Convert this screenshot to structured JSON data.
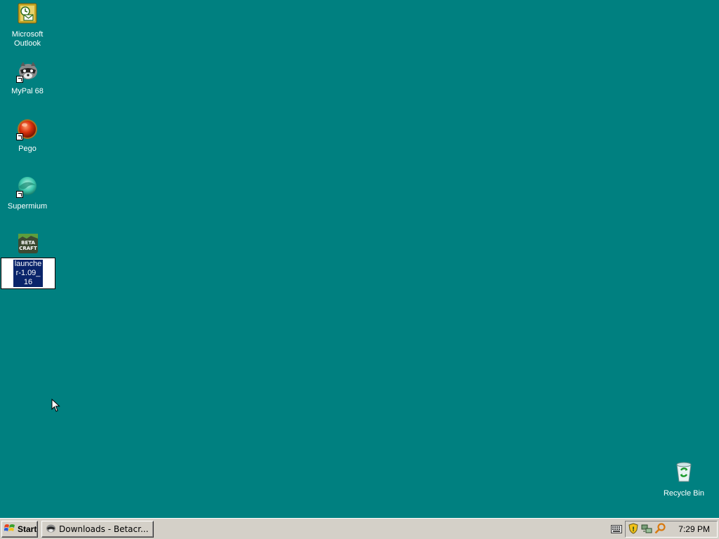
{
  "desktop": {
    "background_color": "#008080",
    "icons": [
      {
        "label": "Microsoft Outlook",
        "icon": "outlook-icon"
      },
      {
        "label": "MyPal 68",
        "icon": "mypal-raccoon-icon",
        "shortcut": true
      },
      {
        "label": "Pego",
        "icon": "pego-red-sphere-icon",
        "shortcut": true
      },
      {
        "label": "Supermium",
        "icon": "supermium-icon",
        "shortcut": true
      },
      {
        "label": "launcher-1.09_16",
        "icon": "betacraft-icon",
        "logo_text": "BETA CRAFT",
        "selected": true
      },
      {
        "label": "Recycle Bin",
        "icon": "recycle-bin-icon"
      }
    ]
  },
  "taskbar": {
    "start_label": "Start",
    "tasks": [
      {
        "label": "Downloads - Betacr...",
        "icon": "mypal-raccoon-icon"
      }
    ],
    "tray": {
      "icons": [
        "keyboard-icon",
        "security-shield-icon",
        "network-icon",
        "search-key-icon"
      ],
      "clock": "7:29 PM"
    }
  },
  "colors": {
    "desktop": "#008080",
    "taskbar": "#d4d0c8",
    "selection": "#0a246a"
  }
}
